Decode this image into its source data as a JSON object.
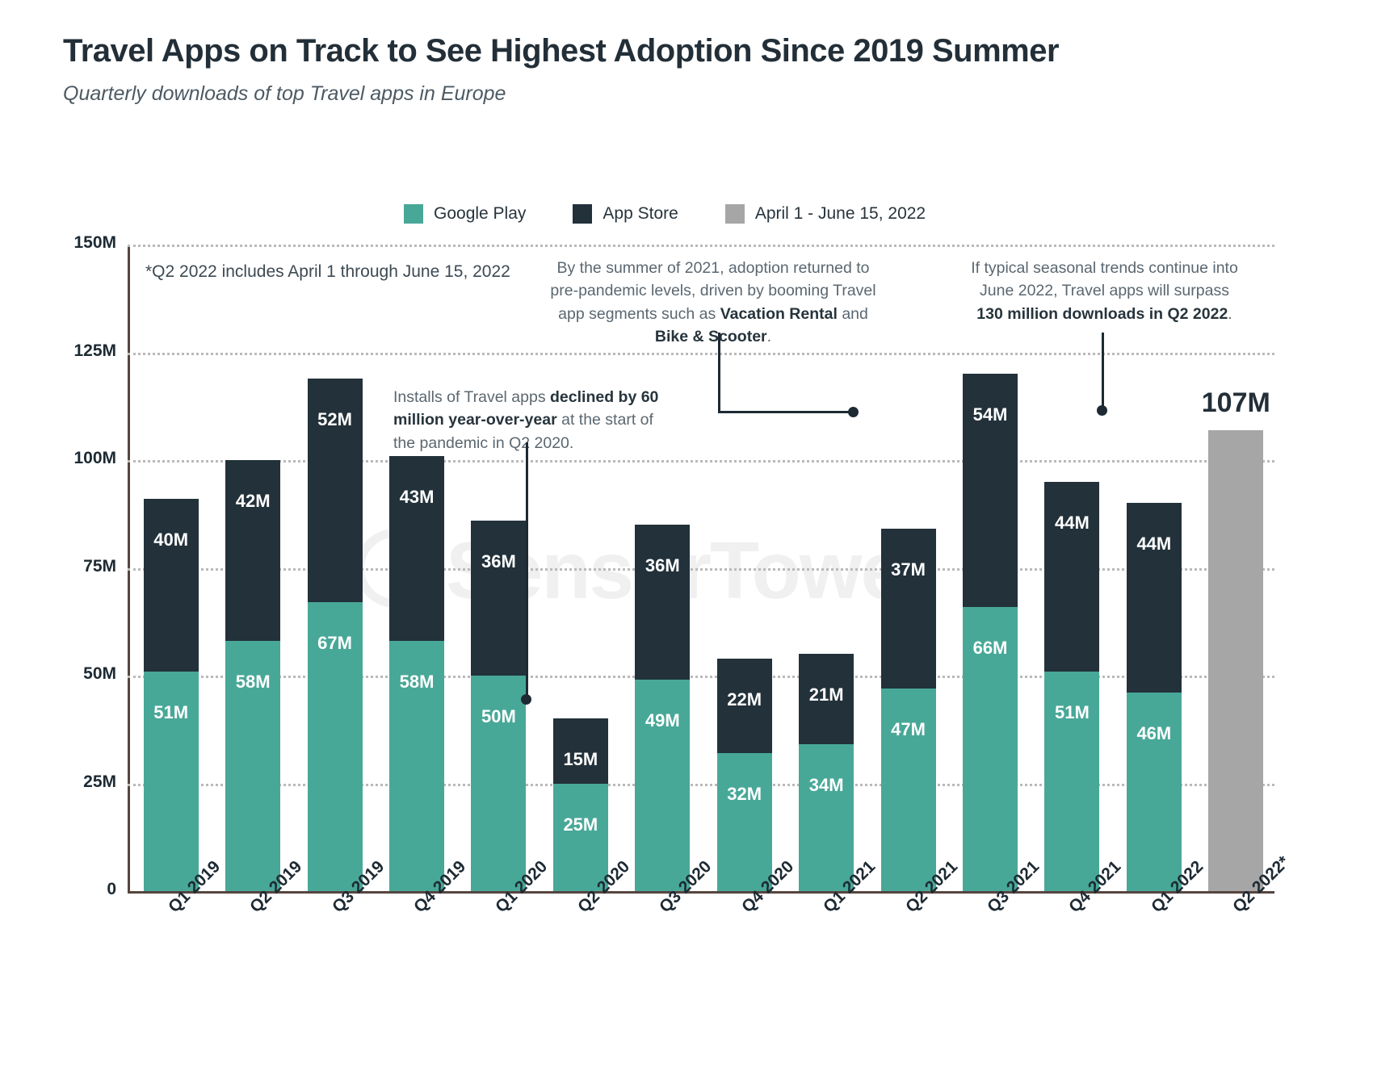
{
  "header": {
    "title": "Travel Apps on Track to See Highest Adoption Since 2019 Summer",
    "subtitle": "Quarterly downloads of top Travel apps in Europe"
  },
  "legend": {
    "items": [
      {
        "label": "Google Play",
        "color": "#48a898"
      },
      {
        "label": "App Store",
        "color": "#22313a"
      },
      {
        "label": "April 1 - June 15, 2022",
        "color": "#a6a6a6"
      }
    ]
  },
  "annotations": {
    "footnote": "*Q2 2022 includes April 1 through June 15, 2022",
    "mid": {
      "part1": "By the summer of 2021, adoption returned to pre-pandemic levels, driven by booming Travel app segments such as ",
      "bold1": "Vacation Rental",
      "part2": " and ",
      "bold2": "Bike & Scooter",
      "part3": "."
    },
    "right": {
      "part1": "If typical seasonal trends continue into June 2022, Travel apps will surpass ",
      "bold1": "130 million downloads in Q2 2022",
      "part2": "."
    },
    "left": {
      "part1": "Installs of Travel apps ",
      "bold1": "declined by 60 million year-over-year",
      "part2": " at the start of the pandemic in Q2 2020."
    }
  },
  "watermark": "SensorTower",
  "chart_data": {
    "type": "bar",
    "title": "Travel Apps on Track to See Highest Adoption Since 2019 Summer",
    "subtitle": "Quarterly downloads of top Travel apps in Europe",
    "xlabel": "",
    "ylabel": "",
    "ylim": [
      0,
      150
    ],
    "grid": true,
    "legend_position": "top-center",
    "stacked": true,
    "units": "millions of downloads",
    "yticks": [
      "0",
      "25M",
      "50M",
      "75M",
      "100M",
      "125M",
      "150M"
    ],
    "ytick_values": [
      0,
      25,
      50,
      75,
      100,
      125,
      150
    ],
    "categories": [
      "Q1 2019",
      "Q2 2019",
      "Q3 2019",
      "Q4 2019",
      "Q1 2020",
      "Q2 2020",
      "Q3 2020",
      "Q4 2020",
      "Q1 2021",
      "Q2 2021",
      "Q3 2021",
      "Q4 2021",
      "Q1 2022",
      "Q2 2022*"
    ],
    "series": [
      {
        "name": "Google Play",
        "color": "#48a898",
        "values": [
          51,
          58,
          67,
          58,
          50,
          25,
          49,
          32,
          34,
          47,
          66,
          51,
          46,
          null
        ],
        "labels": [
          "51M",
          "58M",
          "67M",
          "58M",
          "50M",
          "25M",
          "49M",
          "32M",
          "34M",
          "47M",
          "66M",
          "51M",
          "46M",
          null
        ]
      },
      {
        "name": "App Store",
        "color": "#22313a",
        "values": [
          40,
          42,
          52,
          43,
          36,
          15,
          36,
          22,
          21,
          37,
          54,
          44,
          44,
          null
        ],
        "labels": [
          "40M",
          "42M",
          "52M",
          "43M",
          "36M",
          "15M",
          "36M",
          "22M",
          "21M",
          "37M",
          "54M",
          "44M",
          "44M",
          null
        ]
      },
      {
        "name": "April 1 - June 15, 2022",
        "color": "#a6a6a6",
        "values": [
          null,
          null,
          null,
          null,
          null,
          null,
          null,
          null,
          null,
          null,
          null,
          null,
          null,
          107
        ],
        "labels": [
          null,
          null,
          null,
          null,
          null,
          null,
          null,
          null,
          null,
          null,
          null,
          null,
          null,
          "107M"
        ]
      }
    ],
    "totals": [
      91,
      100,
      119,
      101,
      86,
      40,
      85,
      54,
      55,
      84,
      120,
      95,
      90,
      107
    ],
    "top_labels": [
      null,
      null,
      null,
      null,
      null,
      null,
      null,
      null,
      null,
      null,
      null,
      null,
      null,
      "107M"
    ]
  }
}
